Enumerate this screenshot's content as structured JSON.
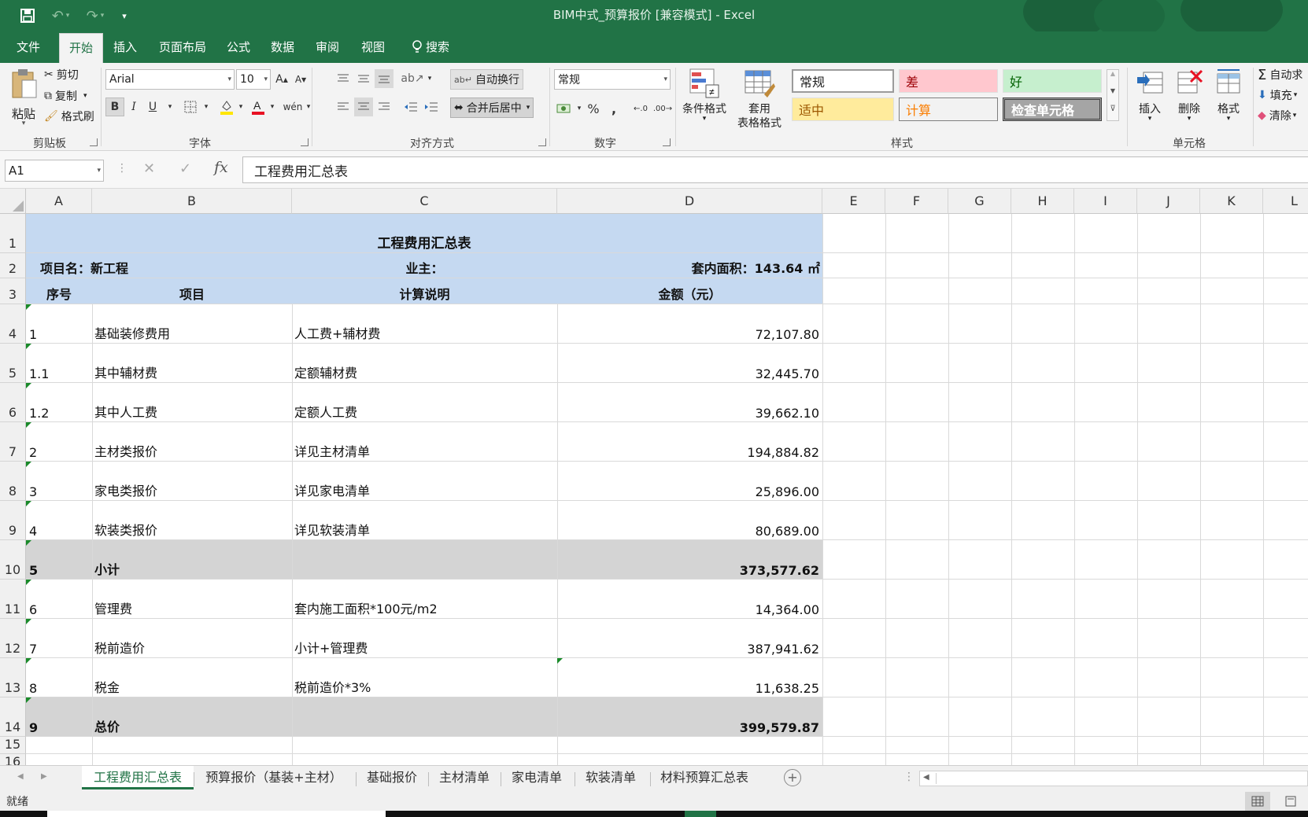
{
  "window": {
    "title": "BIM中式_预算报价  [兼容模式]  -  Excel"
  },
  "ribbon_tabs": [
    "文件",
    "开始",
    "插入",
    "页面布局",
    "公式",
    "数据",
    "审阅",
    "视图",
    "搜索"
  ],
  "ribbon": {
    "clipboard": {
      "paste": "粘贴",
      "cut": "剪切",
      "copy": "复制",
      "format_painter": "格式刷",
      "label": "剪贴板"
    },
    "font": {
      "name": "Arial",
      "size": "10",
      "label": "字体"
    },
    "alignment": {
      "wrap": "自动换行",
      "merge": "合并后居中",
      "label": "对齐方式"
    },
    "number": {
      "format": "常规",
      "label": "数字"
    },
    "styles": {
      "conditional": "条件格式",
      "table_format_1": "套用",
      "table_format_2": "表格格式",
      "cells": [
        "常规",
        "差",
        "好",
        "适中",
        "计算",
        "检查单元格"
      ],
      "label": "样式"
    },
    "cells_group": {
      "insert": "插入",
      "delete": "删除",
      "format": "格式",
      "label": "单元格"
    },
    "editing": {
      "autosum": "自动求",
      "fill": "填充",
      "clear": "清除"
    }
  },
  "formula_bar": {
    "name_box": "A1",
    "formula": "工程费用汇总表"
  },
  "columns": [
    "A",
    "B",
    "C",
    "D",
    "E",
    "F",
    "G",
    "H",
    "I",
    "J",
    "K",
    "L"
  ],
  "sheet": {
    "title": "工程费用汇总表",
    "project_label": "项目名：新工程",
    "owner_label": "业主：",
    "area_label": "套内面积：143.64 ㎡",
    "headers": [
      "序号",
      "项目",
      "计算说明",
      "金额（元）"
    ],
    "rows": [
      {
        "row": "4",
        "no": "1",
        "item": "基础装修费用",
        "desc": "人工费+辅材费",
        "amount": "72,107.80"
      },
      {
        "row": "5",
        "no": "1.1",
        "item": "其中辅材费",
        "desc": "定额辅材费",
        "amount": "32,445.70"
      },
      {
        "row": "6",
        "no": "1.2",
        "item": "其中人工费",
        "desc": "定额人工费",
        "amount": "39,662.10"
      },
      {
        "row": "7",
        "no": "2",
        "item": "主材类报价",
        "desc": "详见主材清单",
        "amount": "194,884.82"
      },
      {
        "row": "8",
        "no": "3",
        "item": "家电类报价",
        "desc": "详见家电清单",
        "amount": "25,896.00"
      },
      {
        "row": "9",
        "no": "4",
        "item": "软装类报价",
        "desc": "详见软装清单",
        "amount": "80,689.00"
      },
      {
        "row": "10",
        "no": "5",
        "item": "小计",
        "desc": "",
        "amount": "373,577.62"
      },
      {
        "row": "11",
        "no": "6",
        "item": "管理费",
        "desc": "套内施工面积*100元/m2",
        "amount": "14,364.00"
      },
      {
        "row": "12",
        "no": "7",
        "item": "税前造价",
        "desc": "小计+管理费",
        "amount": "387,941.62"
      },
      {
        "row": "13",
        "no": "8",
        "item": "税金",
        "desc": "税前造价*3%",
        "amount": "11,638.25"
      },
      {
        "row": "14",
        "no": "9",
        "item": "总价",
        "desc": "",
        "amount": "399,579.87"
      }
    ],
    "row_numbers": [
      "1",
      "2",
      "3",
      "15",
      "16"
    ]
  },
  "sheet_tabs": [
    "工程费用汇总表",
    "预算报价（基装+主材）",
    "基础报价",
    "主材清单",
    "家电清单",
    "软装清单",
    "材料预算汇总表"
  ],
  "status": {
    "ready": "就绪"
  },
  "colors": {
    "excel_green": "#217346",
    "header_fill": "#c5d9f1",
    "subtotal_fill": "#d4d4d4"
  }
}
